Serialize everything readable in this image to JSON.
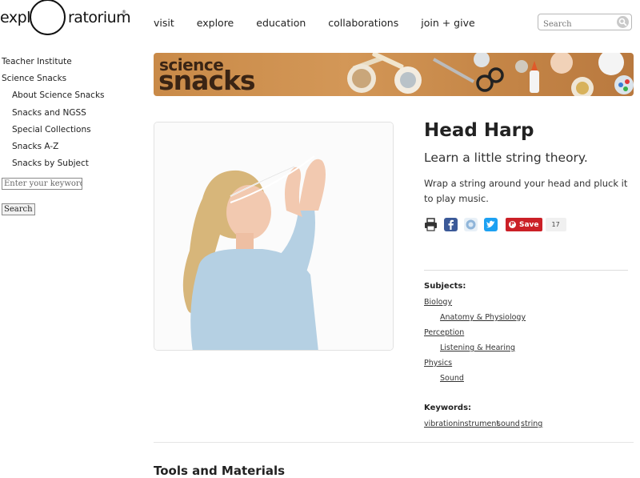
{
  "logo": {
    "left_text": "expl",
    "right_text": "ratorium",
    "mark": "®"
  },
  "topnav": {
    "items": [
      "visit",
      "explore",
      "education",
      "collaborations",
      "join + give"
    ]
  },
  "search": {
    "placeholder": "Search"
  },
  "sidebar": {
    "items": [
      "Teacher Institute",
      "Science Snacks",
      "About Science Snacks",
      "Snacks and NGSS",
      "Special Collections",
      "Snacks A-Z",
      "Snacks by Subject"
    ],
    "keyword_placeholder": "Enter your keywords",
    "search_button": "Search"
  },
  "banner": {
    "line1": "science",
    "line2": "snacks"
  },
  "article": {
    "title": "Head Harp",
    "subtitle": "Learn a little string theory.",
    "description": "Wrap a string around your head and pluck it to play music."
  },
  "social": {
    "icons": [
      "print-icon",
      "facebook-icon",
      "delicious-icon",
      "twitter-icon"
    ],
    "save_label": "Save",
    "count": "17"
  },
  "subjects": {
    "heading": "Subjects:",
    "groups": [
      {
        "name": "Biology",
        "sub": "Anatomy & Physiology"
      },
      {
        "name": "Perception",
        "sub": "Listening & Hearing"
      },
      {
        "name": "Physics",
        "sub": "Sound"
      }
    ]
  },
  "keywords": {
    "heading": "Keywords:",
    "items": [
      "vibration",
      "instrument",
      "sound",
      "string"
    ]
  },
  "section": {
    "tools_heading": "Tools and Materials"
  },
  "colors": {
    "banner": "#c98a48",
    "pinterest": "#cb2027",
    "facebook": "#3b5998",
    "twitter": "#1da1f2"
  }
}
